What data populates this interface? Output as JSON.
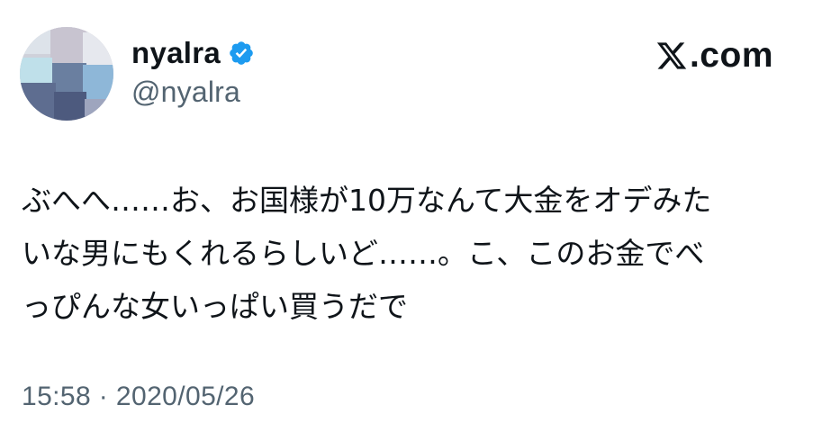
{
  "author": {
    "display_name": "nyalra",
    "handle": "@nyalra",
    "verified": true,
    "avatar_icon": "pixelated-avatar"
  },
  "brand": {
    "label": ".com",
    "icon": "x-logo-icon"
  },
  "post": {
    "lines": [
      "ぶへへ……お、お国様が10万なんて大金をオデみた",
      "いな男にもくれるらしいど……。こ、このお金でべ",
      "っぴんな女いっぱい買うだで"
    ]
  },
  "meta": {
    "timestamp": "15:58 · 2020/05/26"
  },
  "colors": {
    "text_primary": "#0f1419",
    "text_secondary": "#536471",
    "verified_blue": "#1d9bf0",
    "background": "#ffffff"
  }
}
